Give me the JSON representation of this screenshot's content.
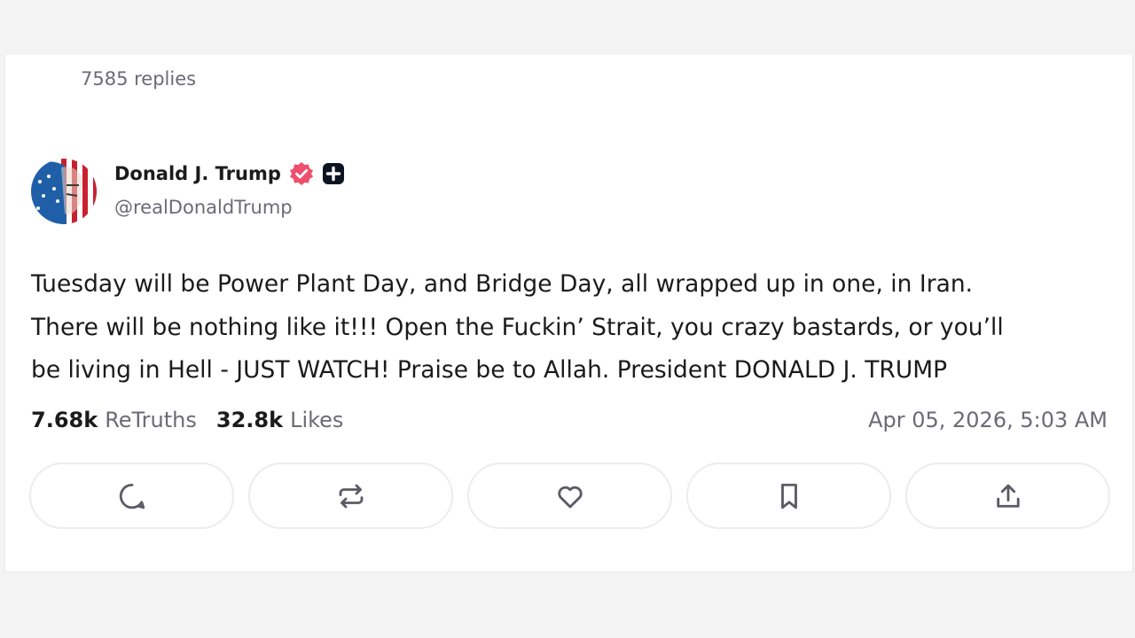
{
  "post": {
    "replies_text": "7585 replies",
    "author": {
      "display_name": "Donald J. Trump",
      "handle": "@realDonaldTrump",
      "verified_color": "#ee4f6f"
    },
    "text_lines": [
      "Tuesday will be Power Plant Day, and Bridge Day, all wrapped up in one, in Iran.",
      "There will be nothing like it!!! Open the Fuckin’ Strait, you crazy bastards, or you’ll",
      "be living in Hell - JUST WATCH! Praise be to Allah. President DONALD J. TRUMP"
    ],
    "stats": {
      "retruths_count": "7.68k",
      "retruths_label": "ReTruths",
      "likes_count": "32.8k",
      "likes_label": "Likes"
    },
    "timestamp": "Apr 05, 2026, 5:03 AM"
  },
  "actions": [
    {
      "icon": "reply-icon"
    },
    {
      "icon": "retruth-icon"
    },
    {
      "icon": "like-icon"
    },
    {
      "icon": "bookmark-icon"
    },
    {
      "icon": "share-icon"
    }
  ]
}
